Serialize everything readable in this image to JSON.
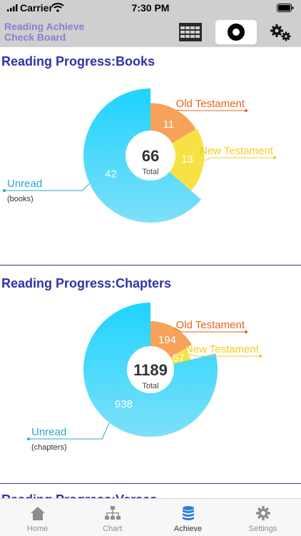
{
  "status": {
    "carrier": "Carrier",
    "time": "7:30 PM"
  },
  "header": {
    "app_title_line1": "Reading Achieve",
    "app_title_line2": "Check Board",
    "calendar_icon": "calendar-icon",
    "chart_icon": "ring-chart-icon",
    "settings_icon": "gears-icon"
  },
  "sections": [
    {
      "title": "Reading Progress:Books",
      "total_value": "66",
      "total_label": "Total",
      "old_label": "Old Testament",
      "new_label": "New Testament",
      "unread_label": "Unread",
      "unit_label": "(books)",
      "old_value": "11",
      "new_value": "13",
      "unread_value": "42",
      "chart_data": {
        "type": "pie",
        "categories": [
          "Old Testament",
          "New Testament",
          "Unread"
        ],
        "values": [
          11,
          13,
          42
        ],
        "total": 66
      }
    },
    {
      "title": "Reading Progress:Chapters",
      "total_value": "1189",
      "total_label": "Total",
      "old_label": "Old Testament",
      "new_label": "New Testament",
      "unread_label": "Unread",
      "unit_label": "(chapters)",
      "old_value": "194",
      "new_value": "57",
      "unread_value": "938",
      "chart_data": {
        "type": "pie",
        "categories": [
          "Old Testament",
          "New Testament",
          "Unread"
        ],
        "values": [
          194,
          57,
          938
        ],
        "total": 1189
      }
    }
  ],
  "next_section_title": "Reading Progress:Verses",
  "tabs": [
    {
      "label": "Home",
      "icon": "home-icon"
    },
    {
      "label": "Chart",
      "icon": "hierarchy-icon"
    },
    {
      "label": "Achieve",
      "icon": "database-icon"
    },
    {
      "label": "Settings",
      "icon": "gear-icon"
    }
  ],
  "colors": {
    "old": "#f6a25a",
    "new": "#f7e243",
    "unread_top": "#1ed3ff",
    "unread_bottom": "#7de0f8",
    "title": "#3431a6",
    "old_text": "#e4651b",
    "new_text": "#f1cd25",
    "unread_text": "#2aa6cc"
  }
}
